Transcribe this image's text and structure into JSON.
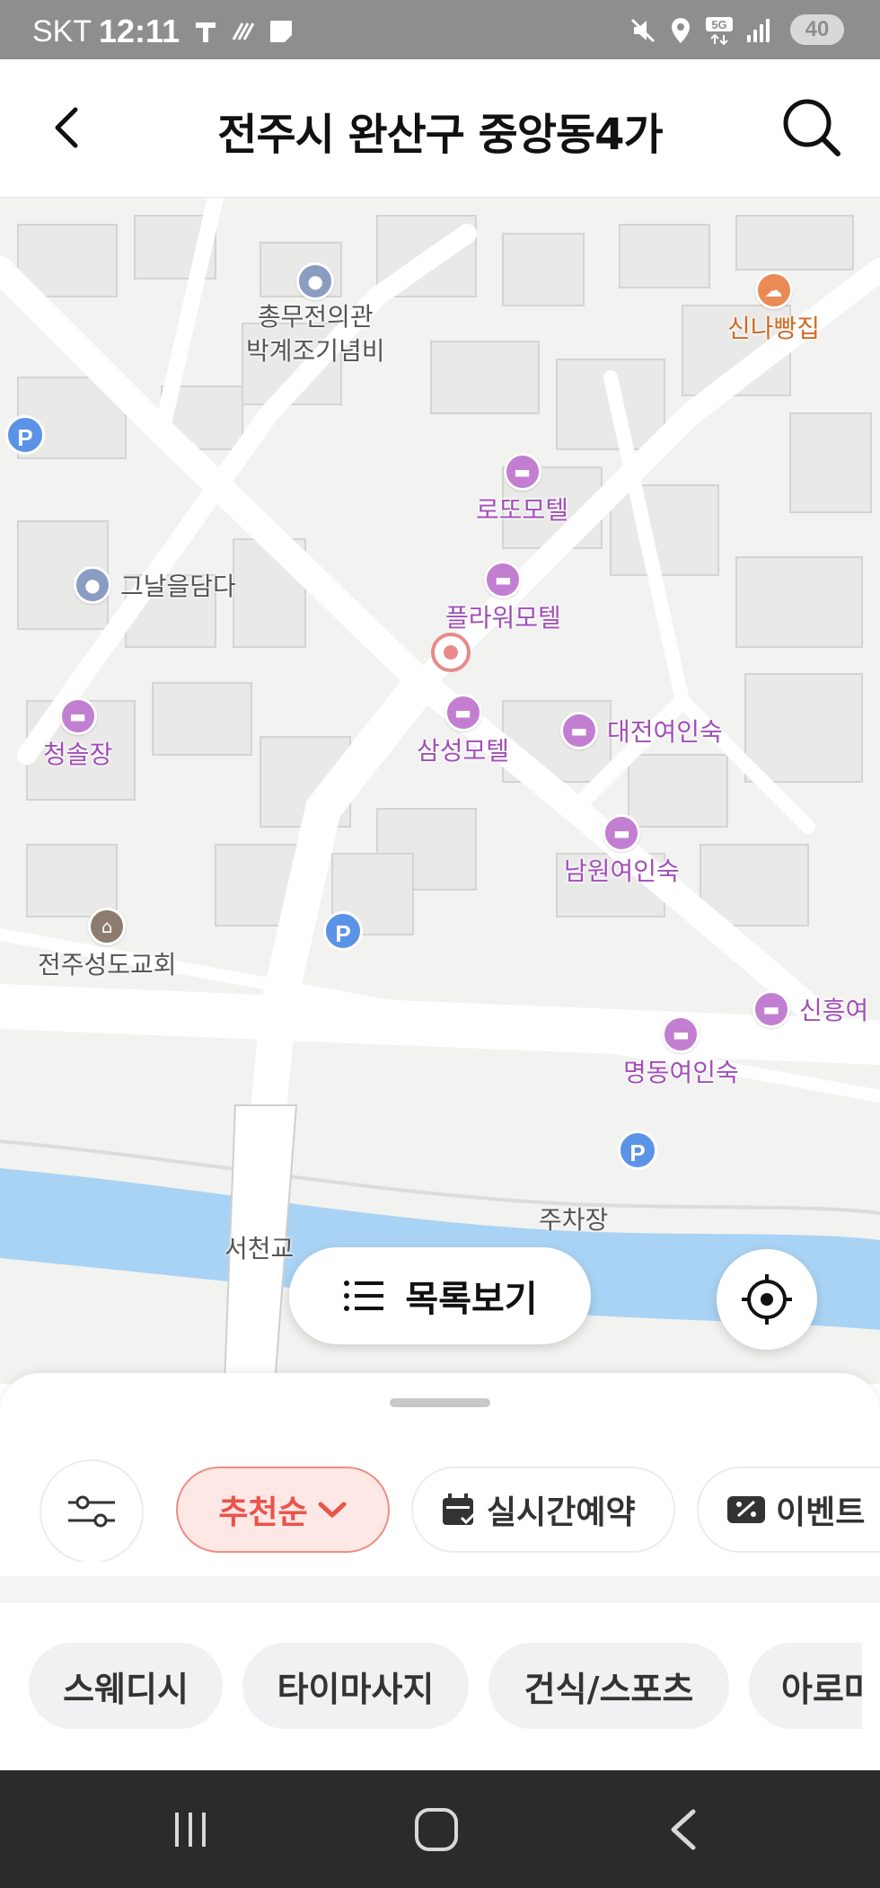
{
  "status_bar": {
    "carrier": "SKT",
    "time": "12:11",
    "network": "5G",
    "battery": "40",
    "left_icons": [
      "t-app-icon",
      "signal-hatch-icon",
      "memo-icon"
    ],
    "right_icons": [
      "mute-icon",
      "location-icon",
      "5g-data-icon",
      "signal-bars-icon"
    ]
  },
  "header": {
    "title": "전주시 완산구 중앙동4가",
    "back_icon": "chevron-left-icon",
    "search_icon": "search-icon"
  },
  "map": {
    "pois": [
      {
        "name": "총무전의관\n박계조기념비",
        "kind": "landmark"
      },
      {
        "name": "신나빵집",
        "kind": "food"
      },
      {
        "name": "로또모텔",
        "kind": "motel"
      },
      {
        "name": "그날을담다",
        "kind": "landmark"
      },
      {
        "name": "플라워모텔",
        "kind": "motel"
      },
      {
        "name": "청솔장",
        "kind": "motel"
      },
      {
        "name": "삼성모텔",
        "kind": "motel"
      },
      {
        "name": "대전여인숙",
        "kind": "motel"
      },
      {
        "name": "남원여인숙",
        "kind": "motel"
      },
      {
        "name": "전주성도교회",
        "kind": "church"
      },
      {
        "name": "신흥여",
        "kind": "motel"
      },
      {
        "name": "명동여인숙",
        "kind": "motel"
      }
    ],
    "labels": {
      "bridge": "서천교",
      "parking": "주차장",
      "parking_marker": "P"
    },
    "list_view_label": "목록보기",
    "locate_icon": "crosshair-icon",
    "list_icon": "list-icon"
  },
  "sheet": {
    "filter_icon": "sliders-icon",
    "sort_label": "추천순",
    "realtime_label": "실시간예약",
    "event_label": "이벤트",
    "categories": [
      "스웨디시",
      "타이마사지",
      "건식/스포츠",
      "아로마"
    ]
  },
  "colors": {
    "accent": "#e9544b",
    "motel": "#c27fd1",
    "parking": "#5b93e6",
    "river": "#a9d3f4"
  }
}
